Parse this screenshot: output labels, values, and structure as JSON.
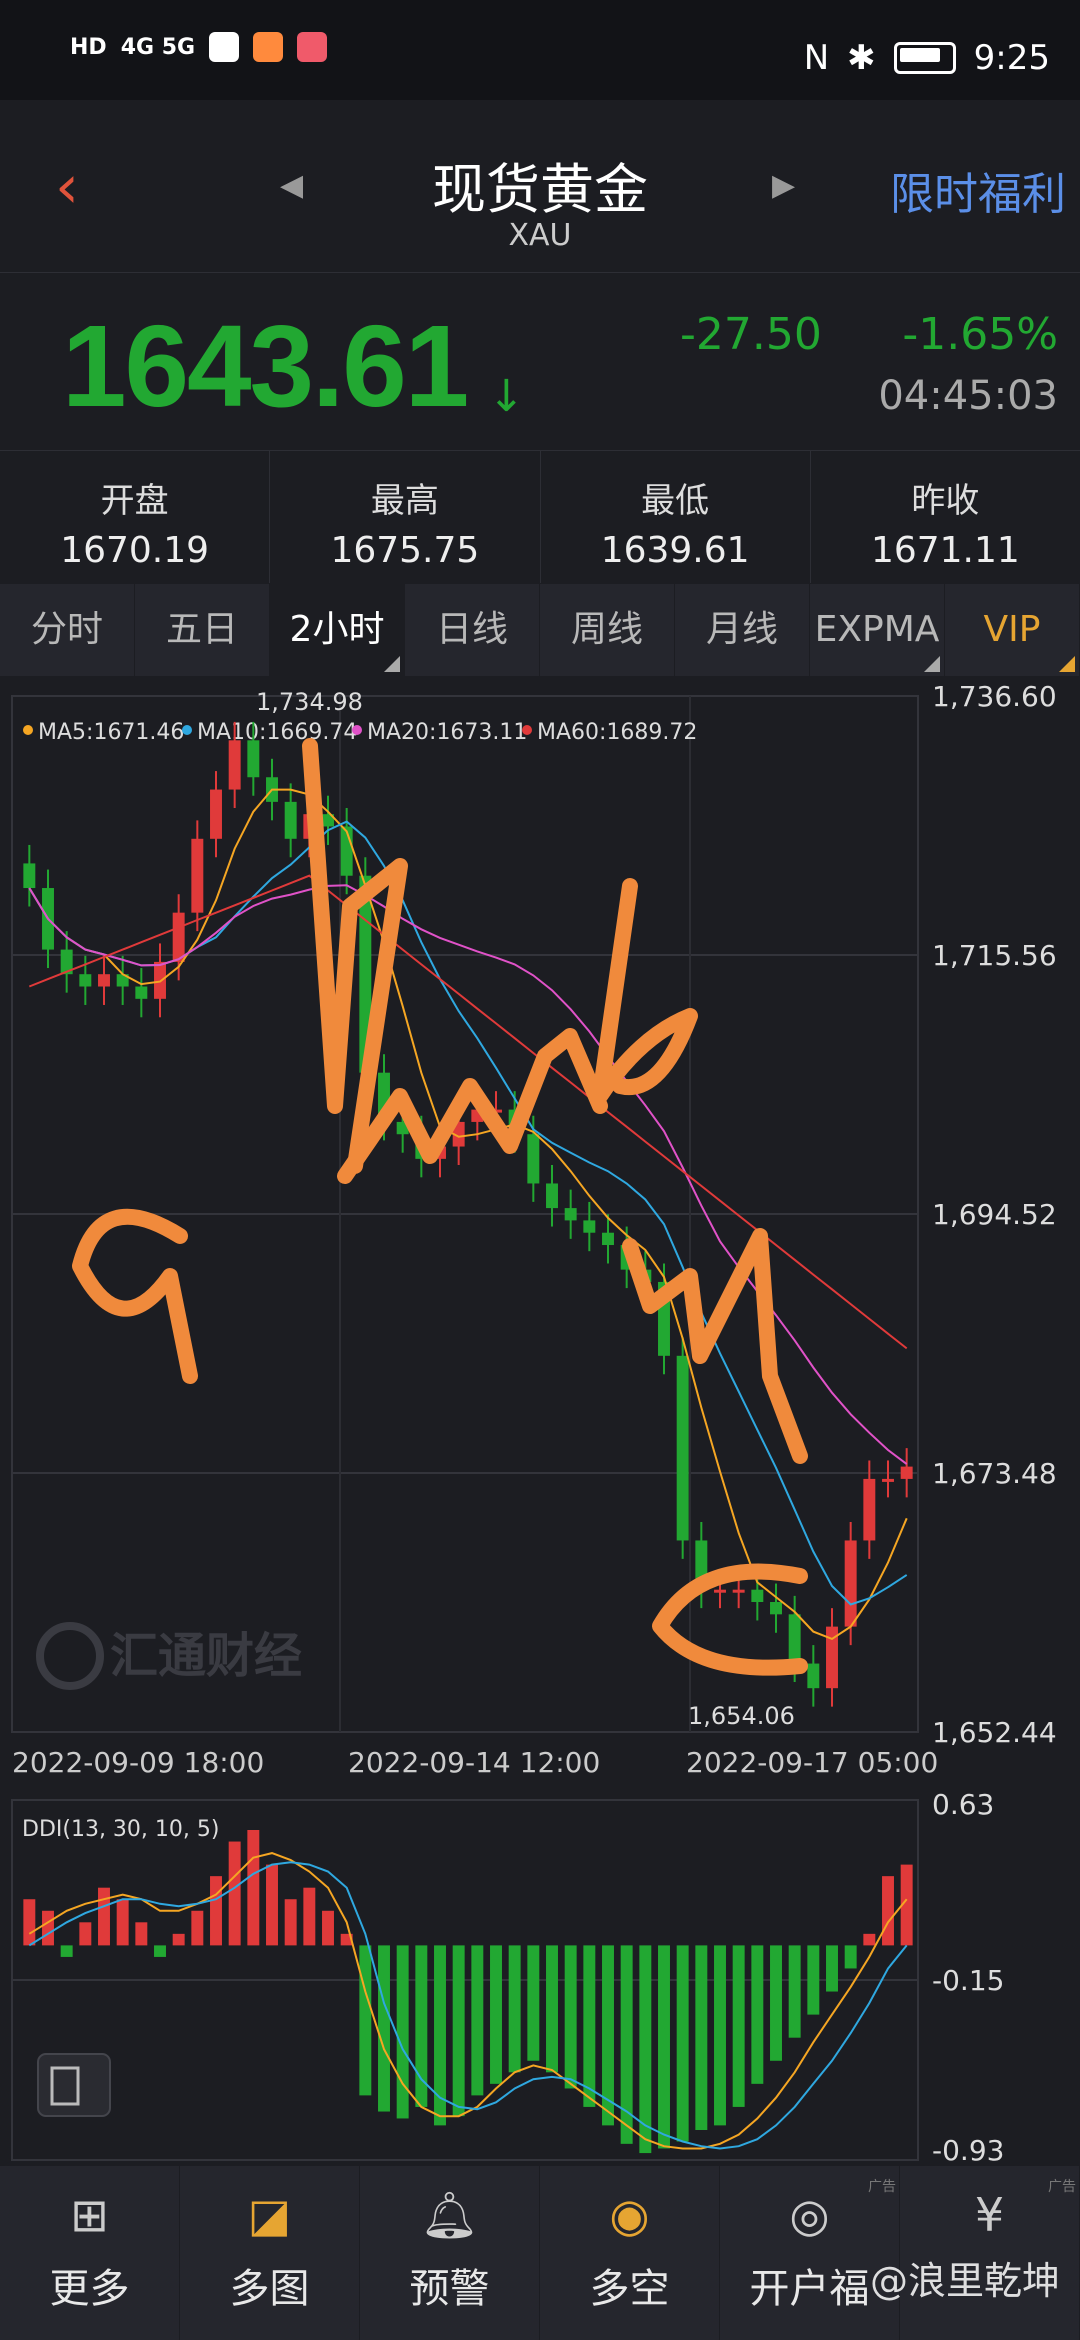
{
  "status_bar": {
    "time": "9:25",
    "network": "4G 5G"
  },
  "header": {
    "back_icon": "‹",
    "title": "现货黄金",
    "subtitle": "XAU",
    "promo_label": "限时福利",
    "prev_icon": "◀",
    "next_icon": "▶"
  },
  "quote": {
    "price": "1643.61",
    "change": "-27.50",
    "percent": "-1.65%",
    "time": "04:45:03",
    "direction_icon": "↓",
    "color_down": "#22a832"
  },
  "stats": [
    {
      "label": "开盘",
      "value": "1670.19"
    },
    {
      "label": "最高",
      "value": "1675.75"
    },
    {
      "label": "最低",
      "value": "1639.61"
    },
    {
      "label": "昨收",
      "value": "1671.11"
    }
  ],
  "tabs": [
    {
      "label": "分时"
    },
    {
      "label": "五日"
    },
    {
      "label": "2小时"
    },
    {
      "label": "日线"
    },
    {
      "label": "周线"
    },
    {
      "label": "月线"
    },
    {
      "label": "EXPMA"
    },
    {
      "label": "VIP"
    }
  ],
  "chart_data": {
    "type": "candlestick",
    "ma_legend": [
      {
        "label": "MA5:1671.46",
        "color": "#f5a623"
      },
      {
        "label": "MA10:1669.74",
        "color": "#2fa8e0"
      },
      {
        "label": "MA20:1673.11",
        "color": "#e052c8"
      },
      {
        "label": "MA60:1689.72",
        "color": "#e03a3a"
      }
    ],
    "y_ticks": [
      "1,736.60",
      "1,715.56",
      "1,694.52",
      "1,673.48",
      "1,652.44"
    ],
    "ylim": [
      1652.44,
      1736.6
    ],
    "x_ticks": [
      "2022-09-09 18:00",
      "2022-09-14 12:00",
      "2022-09-17 05:00"
    ],
    "high_label": "1,734.98",
    "low_label": "1,654.06",
    "watermark": "汇通财经",
    "close_series": [
      1721,
      1716,
      1714,
      1713,
      1714,
      1713,
      1712,
      1715,
      1719,
      1725,
      1729,
      1733,
      1730,
      1728,
      1725,
      1727,
      1726,
      1722,
      1706,
      1702,
      1701,
      1699,
      1700,
      1702,
      1703,
      1703,
      1701,
      1697,
      1695,
      1694,
      1693,
      1692,
      1690,
      1689,
      1683,
      1668,
      1664,
      1664,
      1664,
      1663,
      1662,
      1658,
      1656,
      1661,
      1668,
      1673,
      1673,
      1674
    ],
    "ddi": {
      "label": "DDI(13, 30, 10, 5)",
      "y_ticks": [
        "0.63",
        "-0.15",
        "-0.93"
      ],
      "ylim": [
        -0.93,
        0.63
      ],
      "bars": [
        0.2,
        0.15,
        -0.05,
        0.1,
        0.25,
        0.2,
        0.1,
        -0.05,
        0.05,
        0.15,
        0.3,
        0.45,
        0.5,
        0.35,
        0.2,
        0.25,
        0.15,
        0.05,
        -0.65,
        -0.72,
        -0.75,
        -0.7,
        -0.78,
        -0.74,
        -0.65,
        -0.6,
        -0.55,
        -0.5,
        -0.55,
        -0.62,
        -0.7,
        -0.78,
        -0.86,
        -0.9,
        -0.88,
        -0.85,
        -0.8,
        -0.78,
        -0.7,
        -0.6,
        -0.5,
        -0.4,
        -0.3,
        -0.2,
        -0.1,
        0.05,
        0.3,
        0.35
      ],
      "line1": [
        0.05,
        0.1,
        0.15,
        0.18,
        0.2,
        0.22,
        0.2,
        0.15,
        0.15,
        0.18,
        0.22,
        0.3,
        0.38,
        0.4,
        0.37,
        0.32,
        0.25,
        0.1,
        -0.2,
        -0.45,
        -0.6,
        -0.7,
        -0.74,
        -0.74,
        -0.7,
        -0.62,
        -0.55,
        -0.52,
        -0.54,
        -0.6,
        -0.66,
        -0.72,
        -0.78,
        -0.84,
        -0.87,
        -0.88,
        -0.88,
        -0.86,
        -0.82,
        -0.75,
        -0.66,
        -0.55,
        -0.42,
        -0.3,
        -0.18,
        -0.05,
        0.1,
        0.2
      ],
      "line2": [
        0.0,
        0.05,
        0.1,
        0.14,
        0.17,
        0.2,
        0.2,
        0.18,
        0.17,
        0.18,
        0.2,
        0.25,
        0.31,
        0.35,
        0.36,
        0.35,
        0.32,
        0.25,
        0.05,
        -0.25,
        -0.45,
        -0.58,
        -0.66,
        -0.7,
        -0.71,
        -0.68,
        -0.62,
        -0.58,
        -0.57,
        -0.58,
        -0.62,
        -0.67,
        -0.72,
        -0.78,
        -0.82,
        -0.85,
        -0.87,
        -0.88,
        -0.87,
        -0.84,
        -0.78,
        -0.7,
        -0.6,
        -0.5,
        -0.38,
        -0.25,
        -0.1,
        0.0
      ]
    }
  },
  "nav": [
    {
      "label": "更多",
      "icon": "grid-icon"
    },
    {
      "label": "多图",
      "icon": "multi-chart-icon"
    },
    {
      "label": "预警",
      "icon": "bell-icon"
    },
    {
      "label": "多空",
      "icon": "trend-icon"
    },
    {
      "label": "开户福",
      "icon": "gift-icon"
    },
    {
      "label": "",
      "icon": "money-bag-icon"
    }
  ],
  "watermark_user": "@浪里乾坤",
  "ad_tag": "广告"
}
